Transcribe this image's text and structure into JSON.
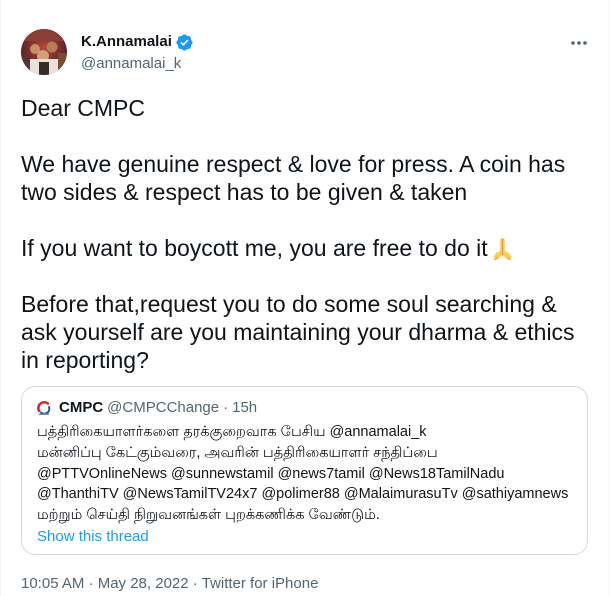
{
  "author": {
    "name": "K.Annamalai",
    "handle": "@annamalai_k",
    "avatar": "avatar-photo",
    "verified_icon": "verified-badge-icon"
  },
  "more_icon": "more-options-icon",
  "tweet": {
    "paragraphs": [
      {
        "lines": [
          "Dear CMPC"
        ]
      },
      {
        "lines": [
          "We have genuine respect & love for press. A coin has",
          "two sides & respect has to be given & taken"
        ]
      },
      {
        "lines": [
          "If you want to boycott me, you are free to do it"
        ],
        "emoji_icon": "folded-hands-emoji-icon"
      },
      {
        "lines": [
          "Before that,request you to do some soul searching &",
          "ask yourself are you maintaining your dharma & ethics",
          "in reporting?"
        ]
      }
    ]
  },
  "quote": {
    "logo_icon": "cmpc-logo-icon",
    "name": "CMPC",
    "handle": "@CMPCChange",
    "separator": "·",
    "time": "15h",
    "lines": [
      "பத்திரிகையாளர்களை தரக்குறைவாக பேசிய @annamalai_k",
      "மன்னிப்பு கேட்கும்வரை, அவரின் பத்திரிகையாளர் சந்திப்பை",
      "@PTTVOnlineNews @sunnewstamil @news7tamil @News18TamilNadu",
      "@ThanthiTV @NewsTamilTV24x7 @polimer88 @MalaimurasuTv @sathiyamnews",
      "மற்றும் செய்தி நிறுவனங்கள் புறக்கணிக்க வேண்டும்."
    ],
    "show_thread": "Show this thread"
  },
  "footer": {
    "timestamp": "10:05 AM · May 28, 2022",
    "separator": "·",
    "source": "Twitter for iPhone"
  },
  "colors": {
    "text": "#0f1419",
    "secondary": "#536471",
    "accent": "#1d9bf0",
    "border": "#cfd9de"
  }
}
